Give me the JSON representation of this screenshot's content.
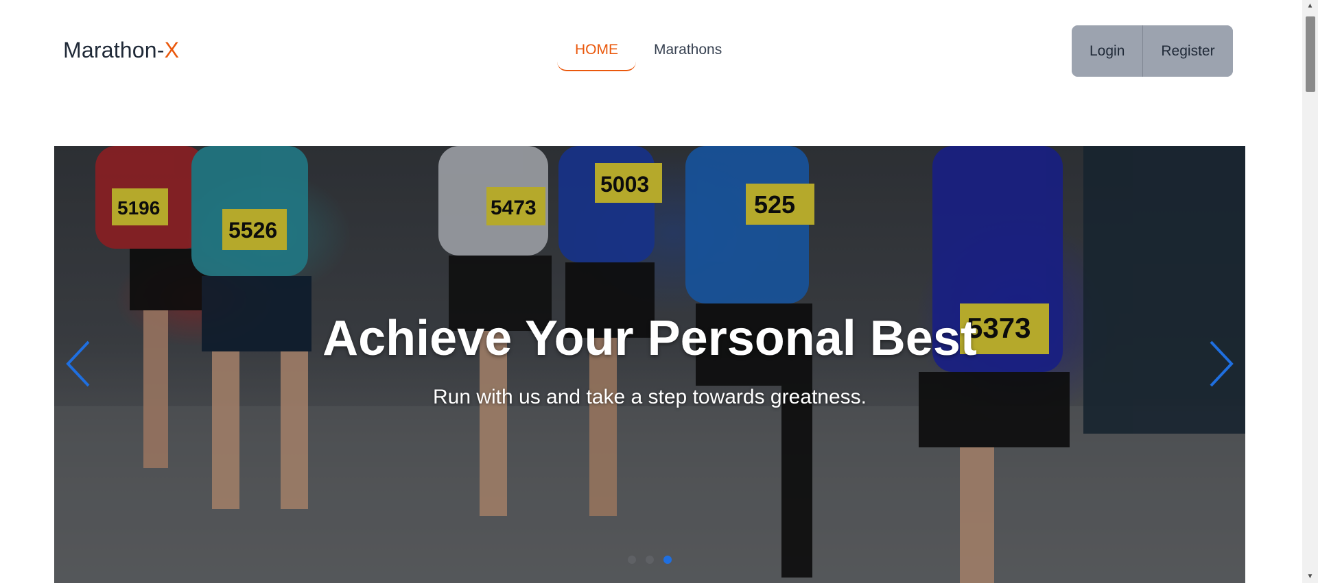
{
  "brand": {
    "name": "Marathon-",
    "accent": "X"
  },
  "nav": {
    "items": [
      {
        "label": "HOME",
        "active": true
      },
      {
        "label": "Marathons",
        "active": false
      }
    ]
  },
  "auth": {
    "login_label": "Login",
    "register_label": "Register"
  },
  "hero": {
    "title": "Achieve Your Personal Best",
    "subtitle": "Run with us and take a step towards greatness.",
    "bib_numbers": [
      "5196",
      "5526",
      "5473",
      "5003",
      "525",
      "5373"
    ],
    "slides_count": 3,
    "active_slide": 3
  },
  "colors": {
    "accent": "#ea580c",
    "auth_button_bg": "#9ca3af",
    "carousel_arrow": "#1f6fe0",
    "active_dot": "#1f6fe0"
  },
  "icons": {
    "prev": "chevron-left-icon",
    "next": "chevron-right-icon",
    "scroll_up": "scroll-up-icon",
    "scroll_down": "scroll-down-icon"
  }
}
